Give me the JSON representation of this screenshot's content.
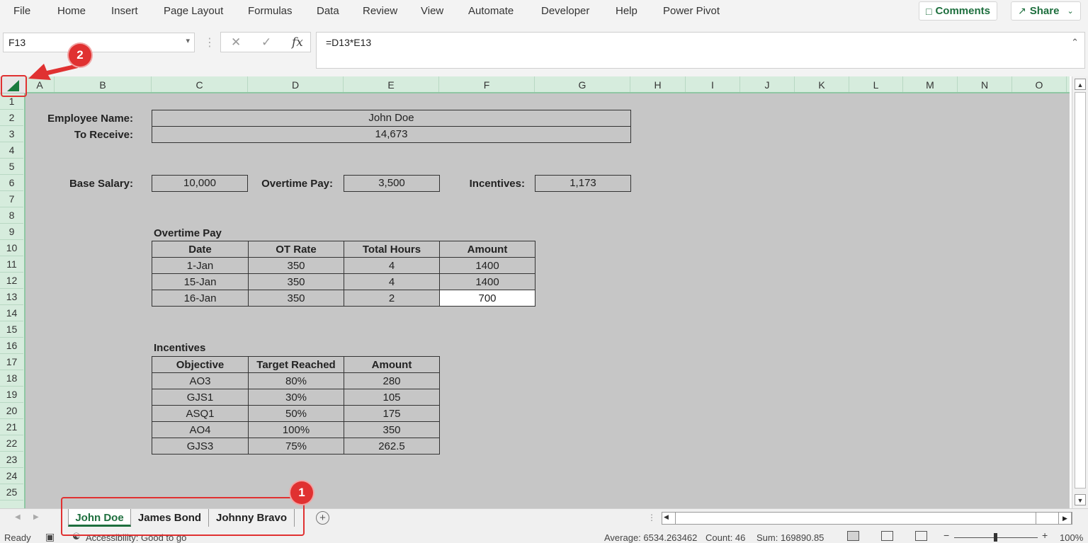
{
  "menu": {
    "items": [
      "File",
      "Home",
      "Insert",
      "Page Layout",
      "Formulas",
      "Data",
      "Review",
      "View",
      "Automate",
      "Developer",
      "Help",
      "Power Pivot"
    ],
    "comments_label": "Comments",
    "share_label": "Share"
  },
  "formula_bar": {
    "name_box": "F13",
    "formula": "=D13*E13"
  },
  "columns": [
    "A",
    "B",
    "C",
    "D",
    "E",
    "F",
    "G",
    "H",
    "I",
    "J",
    "K",
    "L",
    "M",
    "N",
    "O"
  ],
  "rows": [
    "1",
    "2",
    "3",
    "4",
    "5",
    "6",
    "7",
    "8",
    "9",
    "10",
    "11",
    "12",
    "13",
    "14",
    "15",
    "16",
    "17",
    "18",
    "19",
    "20",
    "21",
    "22",
    "23",
    "24",
    "25"
  ],
  "summary": {
    "employee_label": "Employee Name:",
    "employee_value": "John Doe",
    "receive_label": "To Receive:",
    "receive_value": "14,673",
    "base_label": "Base Salary:",
    "base_value": "10,000",
    "ot_label": "Overtime Pay:",
    "ot_value": "3,500",
    "inc_label": "Incentives:",
    "inc_value": "1,173"
  },
  "overtime": {
    "title": "Overtime Pay",
    "headers": [
      "Date",
      "OT Rate",
      "Total Hours",
      "Amount"
    ],
    "rows": [
      [
        "1-Jan",
        "350",
        "4",
        "1400"
      ],
      [
        "15-Jan",
        "350",
        "4",
        "1400"
      ],
      [
        "16-Jan",
        "350",
        "2",
        "700"
      ]
    ]
  },
  "incentives": {
    "title": "Incentives",
    "headers": [
      "Objective",
      "Target Reached",
      "Amount"
    ],
    "rows": [
      [
        "AO3",
        "80%",
        "280"
      ],
      [
        "GJS1",
        "30%",
        "105"
      ],
      [
        "ASQ1",
        "50%",
        "175"
      ],
      [
        "AO4",
        "100%",
        "350"
      ],
      [
        "GJS3",
        "75%",
        "262.5"
      ]
    ]
  },
  "sheets": {
    "tabs": [
      "John Doe",
      "James Bond",
      "Johnny Bravo"
    ],
    "active": "John Doe"
  },
  "status": {
    "ready": "Ready",
    "accessibility": "Accessibility: Good to go",
    "average": "Average: 6534.263462",
    "count": "Count: 46",
    "sum": "Sum: 169890.85",
    "zoom": "100%"
  },
  "callouts": [
    "1",
    "2"
  ],
  "colors": {
    "accent": "#1e6f3e",
    "callout": "#e03131",
    "sheet_bg": "#c6c6c6"
  }
}
